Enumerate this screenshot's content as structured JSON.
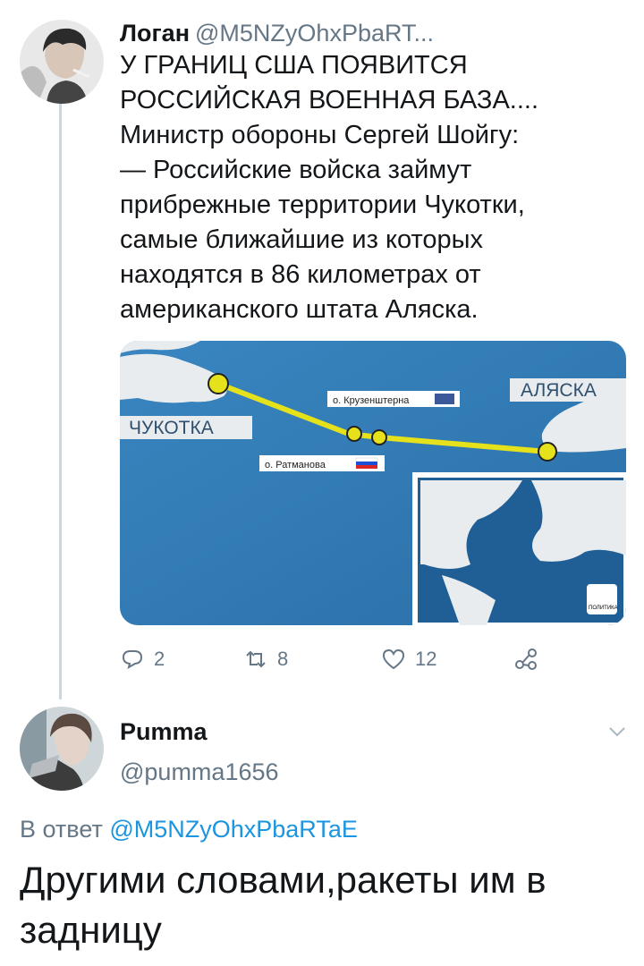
{
  "tweet1": {
    "author_name": "Логан",
    "author_handle": "@M5NZyOhxPbaRT...",
    "text_lines": [
      "У ГРАНИЦ США ПОЯВИТСЯ",
      "РОССИЙСКАЯ ВОЕННАЯ БАЗА....",
      "Министр обороны Сергей Шойгу:",
      "— Российские войска займут",
      "прибрежные территории Чукотки,",
      "самые ближайшие из которых",
      "находятся в 86 километрах от",
      "американского штата Аляска."
    ],
    "media": {
      "label_chukotka": "ЧУКОТКА",
      "label_alaska": "АЛЯСКА",
      "label_kruzenshtern": "о. Крузенштерна",
      "label_ratmanov": "о. Ратманова",
      "logo_text": "ПОЛИТИКА"
    },
    "actions": {
      "reply_count": "2",
      "retweet_count": "8",
      "like_count": "12"
    }
  },
  "tweet2": {
    "author_name": "Pumma",
    "author_handle": "@pumma1656",
    "reply_prefix": "В ответ",
    "reply_mention": "@M5NZyOhxPbaRTaE",
    "text_lines": [
      "Другими словами,ракеты им в",
      "задницу"
    ]
  },
  "colors": {
    "text_primary": "#14171a",
    "text_secondary": "#657786",
    "link": "#1b95e0",
    "thread_line": "#ccd6dd",
    "map_sea": "#2f79b3",
    "route_yellow": "#e5e11a"
  },
  "icons": [
    "reply-icon",
    "retweet-icon",
    "like-icon",
    "share-icon",
    "chevron-down-icon"
  ]
}
